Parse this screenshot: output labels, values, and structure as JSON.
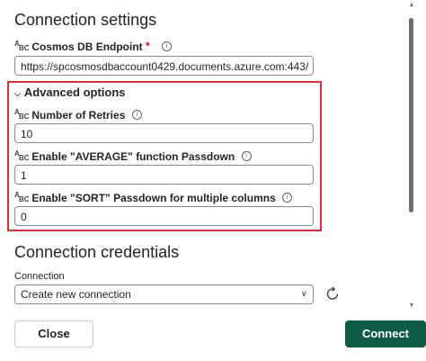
{
  "connection_settings": {
    "title": "Connection settings",
    "endpoint": {
      "label": "Cosmos DB Endpoint",
      "required_mark": "*",
      "value": "https://spcosmosdbaccount0429.documents.azure.com:443/"
    }
  },
  "advanced_options": {
    "header": "Advanced options",
    "fields": [
      {
        "label": "Number of Retries",
        "value": "10"
      },
      {
        "label": "Enable \"AVERAGE\" function Passdown",
        "value": "1"
      },
      {
        "label": "Enable \"SORT\" Passdown for multiple columns",
        "value": "0"
      }
    ],
    "highlight_color": "#d13438"
  },
  "connection_credentials": {
    "title": "Connection credentials",
    "connection_label": "Connection",
    "connection_value": "Create new connection"
  },
  "footer": {
    "close_label": "Close",
    "connect_label": "Connect",
    "connect_color": "#0e5c48"
  },
  "icons": {
    "text_type": "abc-icon",
    "info": "info-icon",
    "refresh": "refresh-icon",
    "chevron": "chevron-down-icon"
  }
}
